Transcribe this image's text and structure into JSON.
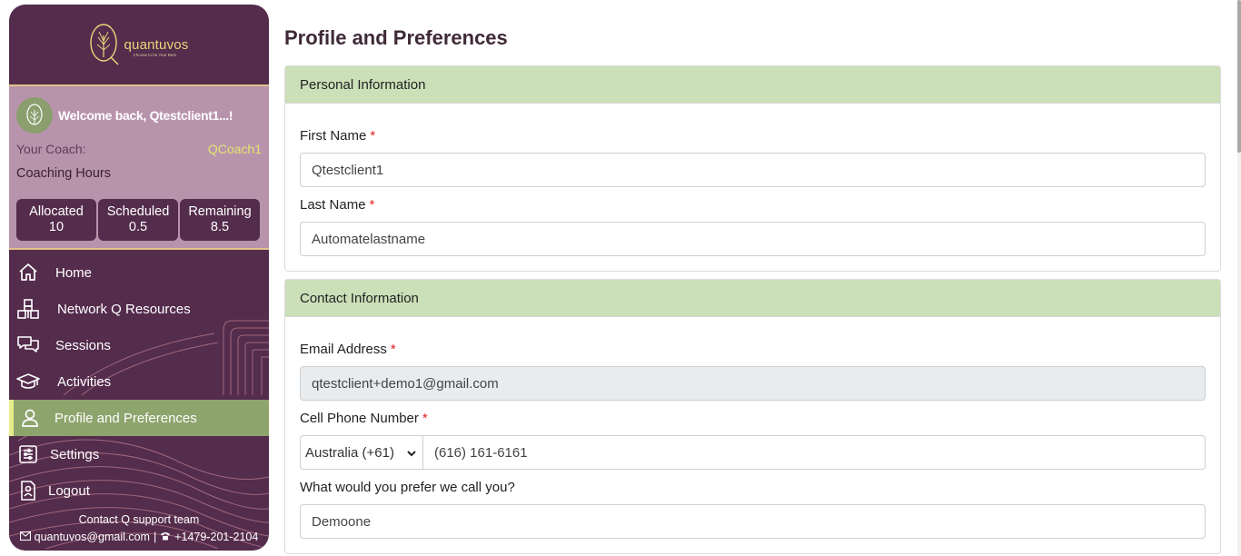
{
  "sidebar": {
    "logo": {
      "name": "quantuvos",
      "tagline": "Choose to be Your Best"
    },
    "welcome": "Welcome back, Qtestclient1...!",
    "coach_label": "Your Coach:",
    "coach_name": "QCoach1",
    "hours_label": "Coaching Hours",
    "hours": [
      {
        "label": "Allocated",
        "value": "10"
      },
      {
        "label": "Scheduled",
        "value": "0.5"
      },
      {
        "label": "Remaining",
        "value": "8.5"
      }
    ],
    "nav": [
      {
        "label": "Home",
        "icon": "home-icon"
      },
      {
        "label": "Network Q Resources",
        "icon": "network-icon"
      },
      {
        "label": "Sessions",
        "icon": "chat-icon"
      },
      {
        "label": "Activities",
        "icon": "graduation-cap-icon"
      },
      {
        "label": "Profile and Preferences",
        "icon": "user-icon",
        "active": true
      },
      {
        "label": "Settings",
        "icon": "settings-icon"
      },
      {
        "label": "Logout",
        "icon": "logout-icon"
      }
    ],
    "contact": {
      "title": "Contact Q support team",
      "email": "quantuvos@gmail.com",
      "separator": "|",
      "phone": "+1479-201-2104"
    }
  },
  "main": {
    "title": "Profile and Preferences",
    "personal": {
      "header": "Personal Information",
      "first_name_label": "First Name",
      "first_name": "Qtestclient1",
      "last_name_label": "Last Name",
      "last_name": "Automatelastname",
      "required_mark": "*"
    },
    "contact": {
      "header": "Contact Information",
      "email_label": "Email Address",
      "email": "qtestclient+demo1@gmail.com",
      "phone_label": "Cell Phone Number",
      "country": "Australia (+61)",
      "phone": "(616) 161-6161",
      "nickname_label": "What would you prefer we call you?",
      "nickname": "Demoone",
      "required_mark": "*"
    }
  },
  "colors": {
    "sidebar_bg": "#542c4c",
    "user_panel_bg": "#b893ac",
    "active_nav_bg": "#8ea46d",
    "card_header_bg": "#cbe0b8",
    "coach_name": "#e2e66e",
    "required": "#e21f1f"
  }
}
